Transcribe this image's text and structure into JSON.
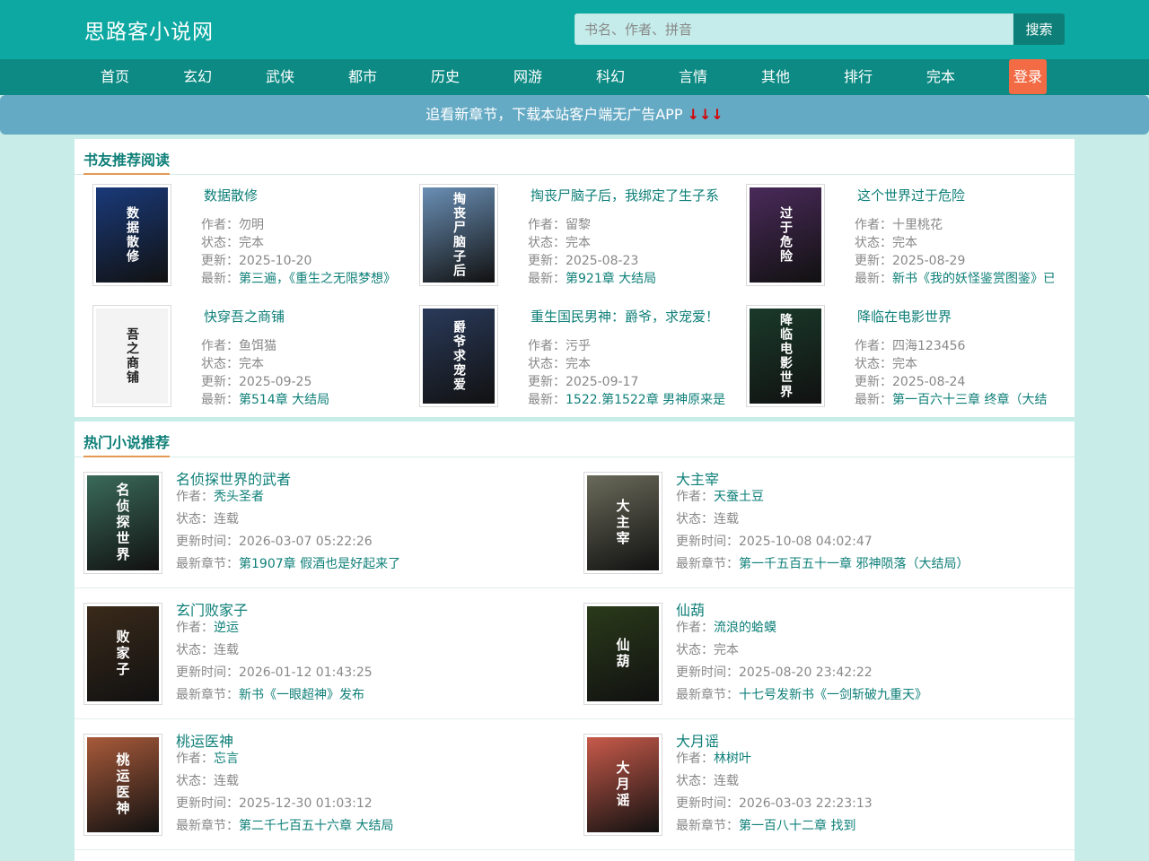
{
  "site": {
    "logo": "思路客小说网",
    "search_placeholder": "书名、作者、拼音",
    "search_button": "搜索",
    "login": "登录"
  },
  "nav": [
    "首页",
    "玄幻",
    "武侠",
    "都市",
    "历史",
    "网游",
    "科幻",
    "言情",
    "其他",
    "排行",
    "完本"
  ],
  "banner": {
    "text": "追看新章节，下载本站客户端无广告APP",
    "arrows": "↓↓↓"
  },
  "recommend": {
    "title": "书友推荐阅读",
    "labels": {
      "author": "作者：",
      "status": "状态：",
      "update": "更新：",
      "latest": "最新："
    },
    "items": [
      {
        "title": "数据散修",
        "author": "勿明",
        "status": "完本",
        "update": "2025-10-20",
        "latest": "第三遍，《重生之无限梦想》",
        "cover_text": "数据散修",
        "cover_color": "#1a3a7a"
      },
      {
        "title": "掏丧尸脑子后，我绑定了生子系",
        "author": "留黎",
        "status": "完本",
        "update": "2025-08-23",
        "latest": "第921章 大结局",
        "cover_text": "掏丧尸脑子后",
        "cover_color": "#6a8fb5"
      },
      {
        "title": "这个世界过于危险",
        "author": "十里桃花",
        "status": "完本",
        "update": "2025-08-29",
        "latest": "新书《我的妖怪鉴赏图鉴》已",
        "cover_text": "过于危险",
        "cover_color": "#4a2a5a"
      },
      {
        "title": "快穿吾之商铺",
        "author": "鱼饵猫",
        "status": "完本",
        "update": "2025-09-25",
        "latest": "第514章 大结局",
        "cover_text": "吾之商铺",
        "cover_color": "#e8e8e8"
      },
      {
        "title": "重生国民男神：爵爷，求宠爱！",
        "author": "污乎",
        "status": "完本",
        "update": "2025-09-17",
        "latest": "1522.第1522章 男神原来是",
        "cover_text": "爵爷求宠爱",
        "cover_color": "#2a3a5a"
      },
      {
        "title": "降临在电影世界",
        "author": "四海123456",
        "status": "完本",
        "update": "2025-08-24",
        "latest": "第一百六十三章 终章（大结",
        "cover_text": "降临电影世界",
        "cover_color": "#1a3a2a"
      }
    ]
  },
  "hot": {
    "title": "热门小说推荐",
    "labels": {
      "author": "作者：",
      "status": "状态：",
      "update": "更新时间：",
      "latest": "最新章节："
    },
    "items": [
      {
        "title": "名侦探世界的武者",
        "author": "秃头圣者",
        "status": "连载",
        "update": "2026-03-07 05:22:26",
        "latest": "第1907章 假酒也是好起来了",
        "cover_text": "名侦探世界",
        "cover_color": "#3a6a5a"
      },
      {
        "title": "大主宰",
        "author": "天蚕土豆",
        "status": "连载",
        "update": "2025-10-08 04:02:47",
        "latest": "第一千五百五十一章 邪神陨落（大结局）",
        "cover_text": "大主宰",
        "cover_color": "#6a6a5a"
      },
      {
        "title": "玄门败家子",
        "author": "逆运",
        "status": "连载",
        "update": "2026-01-12 01:43:25",
        "latest": "新书《一眼超神》发布",
        "cover_text": "败家子",
        "cover_color": "#3a2a1a"
      },
      {
        "title": "仙葫",
        "author": "流浪的蛤蟆",
        "status": "完本",
        "update": "2025-08-20 23:42:22",
        "latest": "十七号发新书《一剑斩破九重天》",
        "cover_text": "仙葫",
        "cover_color": "#2a3a1a"
      },
      {
        "title": "桃运医神",
        "author": "忘言",
        "status": "连载",
        "update": "2025-12-30 01:03:12",
        "latest": "第二千七百五十六章 大结局",
        "cover_text": "桃运医神",
        "cover_color": "#a85a3a"
      },
      {
        "title": "大月谣",
        "author": "林树叶",
        "status": "连载",
        "update": "2026-03-03 22:23:13",
        "latest": "第一百八十二章 找到",
        "cover_text": "大月谣",
        "cover_color": "#c85a4a"
      }
    ]
  }
}
